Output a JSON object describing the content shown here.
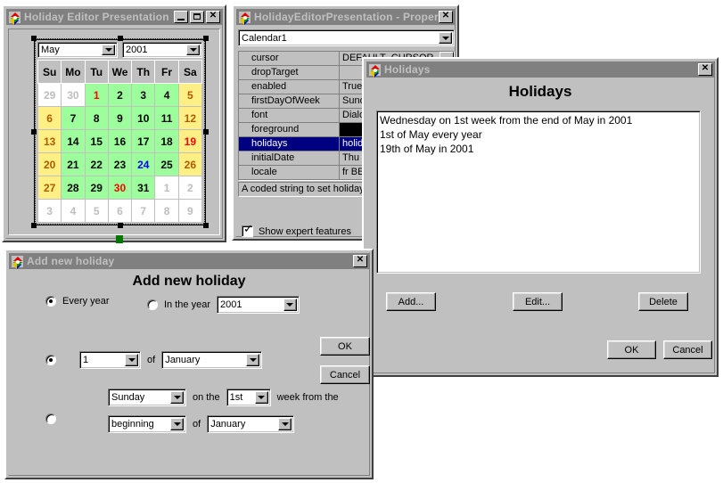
{
  "editor_window": {
    "title": "Holiday Editor Presentation",
    "icon": "app-icon",
    "buttons": {
      "minimize": "minimize",
      "maximize": "maximize",
      "close": "close"
    },
    "calendar": {
      "month_selected": "May",
      "year_selected": "2001",
      "weekday_headers": [
        "Su",
        "Mo",
        "Tu",
        "We",
        "Th",
        "Fr",
        "Sa"
      ],
      "weeks": [
        [
          {
            "text": "29",
            "fg": "#bdbdbd",
            "bg": "#ffffff"
          },
          {
            "text": "30",
            "fg": "#bdbdbd",
            "bg": "#ffffff"
          },
          {
            "text": "1",
            "fg": "#ff0000",
            "bg": "#9cff9c"
          },
          {
            "text": "2",
            "fg": "#000000",
            "bg": "#9cff9c"
          },
          {
            "text": "3",
            "fg": "#000000",
            "bg": "#9cff9c"
          },
          {
            "text": "4",
            "fg": "#000000",
            "bg": "#9cff9c"
          },
          {
            "text": "5",
            "fg": "#b05a00",
            "bg": "#ffef84"
          }
        ],
        [
          {
            "text": "6",
            "fg": "#b05a00",
            "bg": "#ffef84"
          },
          {
            "text": "7",
            "fg": "#000000",
            "bg": "#9cff9c"
          },
          {
            "text": "8",
            "fg": "#000000",
            "bg": "#9cff9c"
          },
          {
            "text": "9",
            "fg": "#000000",
            "bg": "#9cff9c"
          },
          {
            "text": "10",
            "fg": "#000000",
            "bg": "#9cff9c"
          },
          {
            "text": "11",
            "fg": "#000000",
            "bg": "#9cff9c"
          },
          {
            "text": "12",
            "fg": "#b05a00",
            "bg": "#ffef84"
          }
        ],
        [
          {
            "text": "13",
            "fg": "#b05a00",
            "bg": "#ffef84"
          },
          {
            "text": "14",
            "fg": "#000000",
            "bg": "#9cff9c"
          },
          {
            "text": "15",
            "fg": "#000000",
            "bg": "#9cff9c"
          },
          {
            "text": "16",
            "fg": "#000000",
            "bg": "#9cff9c"
          },
          {
            "text": "17",
            "fg": "#000000",
            "bg": "#9cff9c"
          },
          {
            "text": "18",
            "fg": "#000000",
            "bg": "#9cff9c"
          },
          {
            "text": "19",
            "fg": "#ff0000",
            "bg": "#ffef84"
          }
        ],
        [
          {
            "text": "20",
            "fg": "#b05a00",
            "bg": "#ffef84"
          },
          {
            "text": "21",
            "fg": "#000000",
            "bg": "#9cff9c"
          },
          {
            "text": "22",
            "fg": "#000000",
            "bg": "#9cff9c"
          },
          {
            "text": "23",
            "fg": "#000000",
            "bg": "#9cff9c"
          },
          {
            "text": "24",
            "fg": "#0000ff",
            "bg": "#9cff9c"
          },
          {
            "text": "25",
            "fg": "#000000",
            "bg": "#9cff9c"
          },
          {
            "text": "26",
            "fg": "#b05a00",
            "bg": "#ffef84"
          }
        ],
        [
          {
            "text": "27",
            "fg": "#b05a00",
            "bg": "#ffef84"
          },
          {
            "text": "28",
            "fg": "#000000",
            "bg": "#9cff9c"
          },
          {
            "text": "29",
            "fg": "#000000",
            "bg": "#9cff9c"
          },
          {
            "text": "30",
            "fg": "#ff0000",
            "bg": "#9cff9c"
          },
          {
            "text": "31",
            "fg": "#000000",
            "bg": "#9cff9c"
          },
          {
            "text": "1",
            "fg": "#bdbdbd",
            "bg": "#ffffff"
          },
          {
            "text": "2",
            "fg": "#bdbdbd",
            "bg": "#ffffff"
          }
        ],
        [
          {
            "text": "3",
            "fg": "#bdbdbd",
            "bg": "#ffffff"
          },
          {
            "text": "4",
            "fg": "#bdbdbd",
            "bg": "#ffffff"
          },
          {
            "text": "5",
            "fg": "#bdbdbd",
            "bg": "#ffffff"
          },
          {
            "text": "6",
            "fg": "#bdbdbd",
            "bg": "#ffffff"
          },
          {
            "text": "7",
            "fg": "#bdbdbd",
            "bg": "#ffffff"
          },
          {
            "text": "8",
            "fg": "#bdbdbd",
            "bg": "#ffffff"
          },
          {
            "text": "9",
            "fg": "#bdbdbd",
            "bg": "#ffffff"
          }
        ]
      ]
    }
  },
  "properties_window": {
    "title": "HolidayEditorPresentation - Proper...",
    "close_label": "close",
    "component_selected": "Calendar1",
    "rows": [
      {
        "name": "cursor",
        "value": "DEFAULT_CURSOR",
        "selected": false,
        "swatch": false
      },
      {
        "name": "dropTarget",
        "value": "",
        "selected": false,
        "swatch": false
      },
      {
        "name": "enabled",
        "value": "True",
        "selected": false,
        "swatch": false
      },
      {
        "name": "firstDayOfWeek",
        "value": "Sunday",
        "selected": false,
        "swatch": false
      },
      {
        "name": "font",
        "value": "Dialog",
        "selected": false,
        "swatch": false
      },
      {
        "name": "foreground",
        "value": "",
        "selected": false,
        "swatch": true
      },
      {
        "name": "holidays",
        "value": "holidays",
        "selected": true,
        "swatch": false
      },
      {
        "name": "initialDate",
        "value": "Thu",
        "selected": false,
        "swatch": false
      },
      {
        "name": "locale",
        "value": "fr  BE",
        "selected": false,
        "swatch": false
      }
    ],
    "description": "A coded string to set holidays",
    "expert_checkbox": {
      "label": "Show expert features",
      "checked": true
    }
  },
  "holidays_window": {
    "title": "Holidays",
    "close_label": "close",
    "heading": "Holidays",
    "list_items": [
      "Wednesday on 1st week from the end of May in 2001",
      "1st of May every year",
      "19th of May in 2001"
    ],
    "buttons": {
      "add": "Add...",
      "edit": "Edit...",
      "delete": "Delete",
      "ok": "OK",
      "cancel": "Cancel"
    }
  },
  "add_holiday_window": {
    "title": "Add new holiday",
    "close_label": "close",
    "heading": "Add new holiday",
    "scope": {
      "every_year_label": "Every year",
      "every_year_selected": true,
      "in_the_year_label": "In the year",
      "in_the_year_selected": false,
      "year_value": "2001"
    },
    "fixed_date": {
      "selected": true,
      "day_value": "1",
      "of_label": "of",
      "month_value": "January"
    },
    "relative_date": {
      "selected": false,
      "weekday_value": "Sunday",
      "on_the_label": "on the",
      "week_number_value": "1st",
      "week_from_the_label": "week from the",
      "from_end_value": "beginning",
      "of_label": "of",
      "month_value": "January"
    },
    "buttons": {
      "ok": "OK",
      "cancel": "Cancel"
    }
  }
}
